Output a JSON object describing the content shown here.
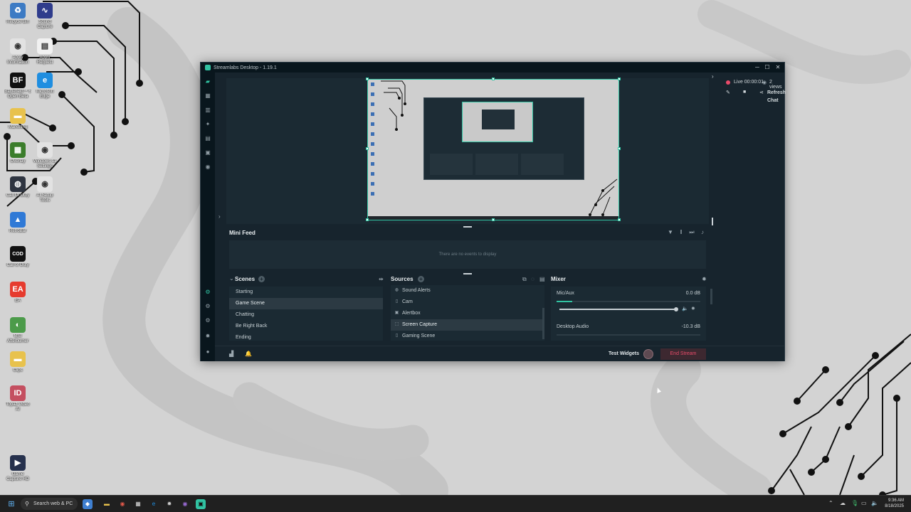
{
  "desktop": {
    "icons": [
      {
        "label": "Recycle Bin",
        "symbol": "♻",
        "color": "#3d7bc4"
      },
      {
        "label": "Sound Capture",
        "symbol": "∿",
        "color": "#2f3c8c"
      },
      {
        "label": "Apply Information",
        "symbol": "◉",
        "color": "#e2e2e2"
      },
      {
        "label": "Apply Request",
        "symbol": "▤",
        "color": "#f1f1f1"
      },
      {
        "label": "Battlefield™ 6 Open Beta",
        "symbol": "BF",
        "color": "#111111"
      },
      {
        "label": "Microsoft Edge",
        "symbol": "e",
        "color": "#1f8ee0"
      },
      {
        "label": "Marketing",
        "symbol": "▬",
        "color": "#e8c24d"
      },
      {
        "label": "Overlay",
        "symbol": "▦",
        "color": "#3b7d2b"
      },
      {
        "label": "Windows 11 Settings",
        "symbol": "◉",
        "color": "#e2e2e2"
      },
      {
        "label": "Call Of Duty",
        "symbol": "◍",
        "color": "#2e3440"
      },
      {
        "label": "AI Setup Tools",
        "symbol": "◉",
        "color": "#e2e2e2"
      },
      {
        "label": "RetroBar",
        "symbol": "▲",
        "color": "#2f79d6"
      },
      {
        "label": "Call of Duty",
        "symbol": "COD",
        "color": "#111111"
      },
      {
        "label": "EA",
        "symbol": "EA",
        "color": "#e63b2e"
      },
      {
        "label": "MSI Afterburner",
        "symbol": "◐",
        "color": "#4c9b4a"
      },
      {
        "label": "Clips",
        "symbol": "▬",
        "color": "#e8c24d"
      },
      {
        "label": "Topaz Video AI",
        "symbol": "ID",
        "color": "#c44f60"
      },
      {
        "label": "Game Capture HD",
        "symbol": "▶",
        "color": "#26314d"
      }
    ]
  },
  "window": {
    "title": "Streamlabs Desktop - 1.19.1",
    "controls": {
      "minimize": "─",
      "maximize": "☐",
      "close": "✕"
    }
  },
  "nav_icons": [
    "editor-icon",
    "dashboard-icon",
    "library-icon",
    "themes-icon",
    "store-icon",
    "layout-icon",
    "apps-icon"
  ],
  "chat": {
    "live_label": "Live 00:00:01",
    "viewers": "2 views",
    "refresh_label": "Refresh",
    "chat_label": "Chat"
  },
  "minifeed": {
    "title": "Mini Feed",
    "empty_text": "There are no events to display"
  },
  "scenes": {
    "title": "Scenes",
    "items": [
      {
        "label": "Starting",
        "active": false
      },
      {
        "label": "Game Scene",
        "active": true
      },
      {
        "label": "Chatting",
        "active": false
      },
      {
        "label": "Be Right Back",
        "active": false
      },
      {
        "label": "Ending",
        "active": false
      }
    ]
  },
  "sources": {
    "title": "Sources",
    "items": [
      {
        "label": "Sound Alerts",
        "icon": "globe-icon",
        "symbol": "◍",
        "active": false
      },
      {
        "label": "Cam",
        "icon": "file-icon",
        "symbol": "▯",
        "active": false
      },
      {
        "label": "Alertbox",
        "icon": "alert-icon",
        "symbol": "▣",
        "active": false
      },
      {
        "label": "Screen Capture",
        "icon": "screen-icon",
        "symbol": "⬚",
        "active": true
      },
      {
        "label": "Gaming Scene",
        "icon": "file-icon",
        "symbol": "▯",
        "active": false
      }
    ]
  },
  "mixer": {
    "title": "Mixer",
    "channels": [
      {
        "name": "Mic/Aux",
        "db": "0.0 dB",
        "level": 0.11,
        "volume": 1.0
      },
      {
        "name": "Desktop Audio",
        "db": "-10.3 dB",
        "level": 0.0,
        "volume": 1.0
      }
    ]
  },
  "bottombar": {
    "test_widgets": "Test Widgets",
    "end_stream": "End Stream"
  },
  "taskbar": {
    "search_placeholder": "Search web & PC",
    "time": "9:36 AM",
    "date": "8/18/2025"
  },
  "colors": {
    "accent": "#31c3a2",
    "end_stream": "#e94b6a",
    "app_bg": "#17242d",
    "panel_bg": "#1b2a33"
  }
}
